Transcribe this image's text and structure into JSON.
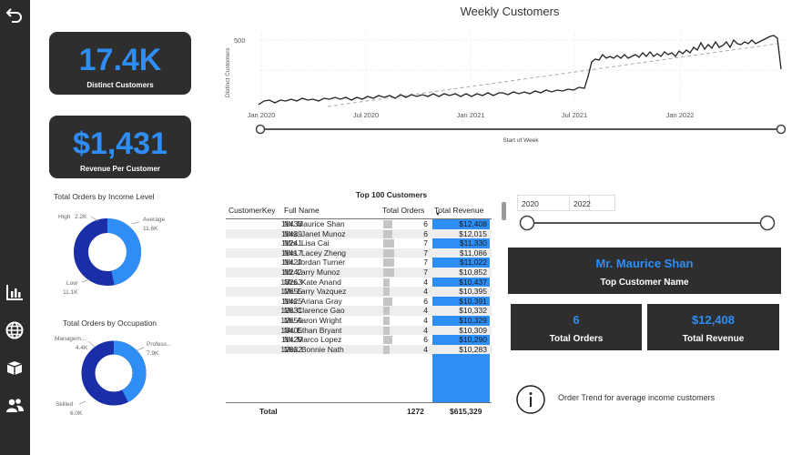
{
  "nav": {
    "icons": [
      "back-icon",
      "bar-chart-icon",
      "globe-icon",
      "box-icon",
      "users-icon"
    ]
  },
  "kpis": {
    "distinct_customers": {
      "value": "17.4K",
      "label": "Distinct Customers"
    },
    "revenue_per_customer": {
      "value": "$1,431",
      "label": "Revenue Per Customer"
    }
  },
  "weekly_chart": {
    "title": "Weekly Customers",
    "xlabel": "Start of Week",
    "ylabel": "Distinct Customers",
    "ytick": "500",
    "xticks": [
      "Jan 2020",
      "Jul 2020",
      "Jan 2021",
      "Jul 2021",
      "Jan 2022"
    ]
  },
  "income_donut": {
    "title": "Total Orders by Income Level",
    "slices": [
      {
        "label": "Average",
        "value": "11.6K",
        "color": "#2e8ef5"
      },
      {
        "label": "Low",
        "value": "11.1K",
        "color": "#1a2ea8"
      },
      {
        "label": "High",
        "value": "2.2K",
        "color": "#e46f2f"
      }
    ]
  },
  "occupation_donut": {
    "title": "Total Orders by Occupation",
    "slices": [
      {
        "label": "Profess...",
        "value": "7.9K",
        "color": "#2e8ef5"
      },
      {
        "label": "Skilled",
        "value": "6.0K",
        "color": "#1a2ea8"
      },
      {
        "label": "Managem...",
        "value": "4.4K",
        "color": "#e46f2f"
      }
    ]
  },
  "table": {
    "title": "Top 100 Customers",
    "headers": {
      "key": "CustomerKey",
      "name": "Full Name",
      "orders": "Total Orders",
      "revenue": "Total Revenue"
    },
    "rows": [
      {
        "key": "11433",
        "name": "Mr. Maurice Shan",
        "orders": "6",
        "revenue": "$12,408"
      },
      {
        "key": "11439",
        "name": "Mrs. Janet Munoz",
        "orders": "6",
        "revenue": "$12,015"
      },
      {
        "key": "11241",
        "name": "Mrs. Lisa Cai",
        "orders": "7",
        "revenue": "$11,330"
      },
      {
        "key": "11417",
        "name": "Mrs. Lacey Zheng",
        "orders": "7",
        "revenue": "$11,086"
      },
      {
        "key": "11420",
        "name": "Mr. Jordan Turner",
        "orders": "7",
        "revenue": "$11,022"
      },
      {
        "key": "11242",
        "name": "Mr. Larry Munoz",
        "orders": "7",
        "revenue": "$10,852"
      },
      {
        "key": "13263",
        "name": "Mrs. Kate Anand",
        "orders": "4",
        "revenue": "$10,437"
      },
      {
        "key": "12655",
        "name": "Mr. Larry Vazquez",
        "orders": "4",
        "revenue": "$10,395"
      },
      {
        "key": "11425",
        "name": "Mrs. Ariana Gray",
        "orders": "6",
        "revenue": "$10,391"
      },
      {
        "key": "12631",
        "name": "Mr. Clarence Gao",
        "orders": "4",
        "revenue": "$10,332"
      },
      {
        "key": "12650",
        "name": "Mr. Aaron Wright",
        "orders": "4",
        "revenue": "$10,329"
      },
      {
        "key": "13405",
        "name": "Mr. Ethan Bryant",
        "orders": "4",
        "revenue": "$10,309"
      },
      {
        "key": "11429",
        "name": "Mr. Marco Lopez",
        "orders": "6",
        "revenue": "$10,290"
      },
      {
        "key": "12632",
        "name": "Mrs. Bonnie Nath",
        "orders": "4",
        "revenue": "$10,283"
      }
    ],
    "total": {
      "label": "Total",
      "orders": "1272",
      "revenue": "$615,329"
    }
  },
  "date_slicer": {
    "start": "2020",
    "end": "2022"
  },
  "top_customer": {
    "name": "Mr. Maurice Shan",
    "name_label": "Top Customer Name",
    "orders": "6",
    "orders_label": "Total Orders",
    "revenue": "$12,408",
    "revenue_label": "Total Revenue"
  },
  "info_note": "Order Trend for average income customers"
}
